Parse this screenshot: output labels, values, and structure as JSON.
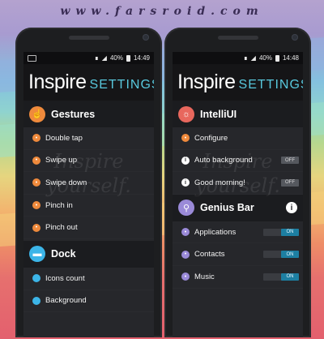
{
  "watermark": "www.farsroid.com",
  "colors": {
    "accent": "#58c8dd",
    "gesture_orange": "#ef8a3c",
    "dock_blue": "#3cb5e8",
    "intelliui_red": "#e8675d",
    "genius_purple": "#9a8ad8",
    "toggle_on": "#1d7fa2"
  },
  "left_phone": {
    "status": {
      "battery": "40%",
      "time": "14:49"
    },
    "header": {
      "title": "Inspire",
      "subtitle": "SETTINGS"
    },
    "background_text": [
      "Inspire",
      "yourself."
    ],
    "sections": [
      {
        "title": "Gestures",
        "icon": "hand-icon",
        "items": [
          {
            "label": "Double tap"
          },
          {
            "label": "Swipe up"
          },
          {
            "label": "Swipe down"
          },
          {
            "label": "Pinch in"
          },
          {
            "label": "Pinch out"
          }
        ]
      },
      {
        "title": "Dock",
        "icon": "dock-icon",
        "items": [
          {
            "label": "Icons count"
          },
          {
            "label": "Background"
          }
        ]
      }
    ]
  },
  "right_phone": {
    "status": {
      "battery": "40%",
      "time": "14:48"
    },
    "header": {
      "title": "Inspire",
      "subtitle": "SETTINGS"
    },
    "background_text": [
      "Inspire",
      "yourself."
    ],
    "sections": [
      {
        "title": "IntelliUI",
        "icon": "lightbulb-icon",
        "items": [
          {
            "label": "Configure",
            "icon": "dot"
          },
          {
            "label": "Auto background",
            "icon": "info",
            "toggle": "OFF"
          },
          {
            "label": "Good morning!",
            "icon": "info",
            "toggle": "OFF"
          }
        ]
      },
      {
        "title": "Genius Bar",
        "icon": "magnifier-icon",
        "info": "i",
        "items": [
          {
            "label": "Applications",
            "toggle": "ON"
          },
          {
            "label": "Contacts",
            "toggle": "ON"
          },
          {
            "label": "Music",
            "toggle": "ON"
          }
        ]
      }
    ]
  }
}
